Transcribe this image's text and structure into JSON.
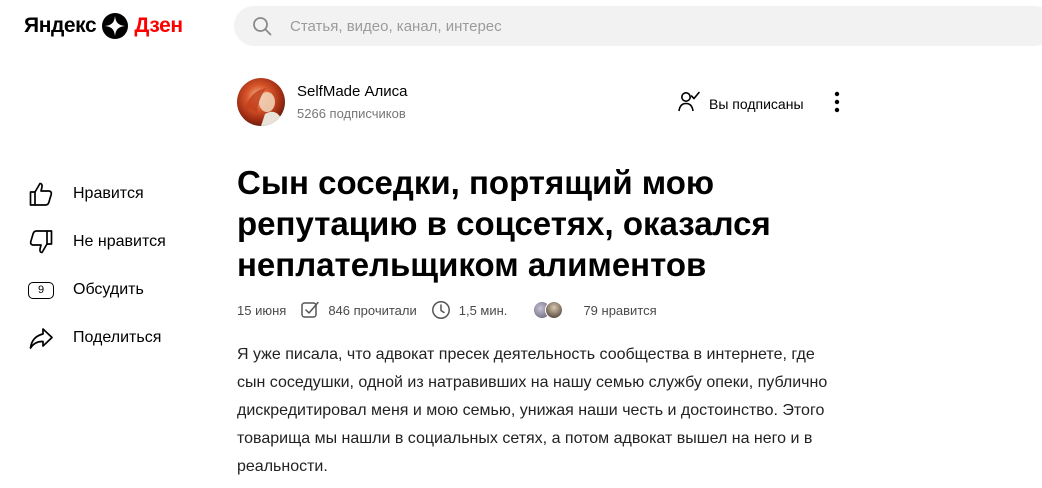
{
  "header": {
    "logo_yandex": "Яндекс",
    "logo_dzen": "Дзен",
    "search_placeholder": "Статья, видео, канал, интерес"
  },
  "channel": {
    "name": "SelfMade Алиса",
    "subscribers": "5266 подписчиков",
    "subscribed_label": "Вы подписаны"
  },
  "sidebar": {
    "like_label": "Нравится",
    "dislike_label": "Не нравится",
    "comments_count": "9",
    "comment_label": "Обсудить",
    "share_label": "Поделиться"
  },
  "article": {
    "title": "Сын соседки, портящий мою репутацию в соцсетях, оказался неплательщиком алиментов",
    "date": "15 июня",
    "reads": "846 прочитали",
    "read_time": "1,5 мин.",
    "likes": "79 нравится",
    "body": "Я уже писала, что адвокат пресек деятельность сообщества в интернете, где сын соседушки, одной из натравивших на нашу семью службу опеки, публично дискредитировал меня и мою семью, унижая наши честь и достоинство. Этого товарища мы нашли в социальных сетях, а потом адвокат вышел на него и в реальности."
  },
  "colors": {
    "brand_red": "#ff0000",
    "search_bg": "#f2f2f2",
    "meta_text": "#4a4a4a"
  },
  "icons": [
    "search-icon",
    "dzen-star-icon",
    "subscribed-icon",
    "more-icon",
    "thumbs-up-icon",
    "thumbs-down-icon",
    "comment-icon",
    "share-icon",
    "reads-icon",
    "clock-icon"
  ]
}
